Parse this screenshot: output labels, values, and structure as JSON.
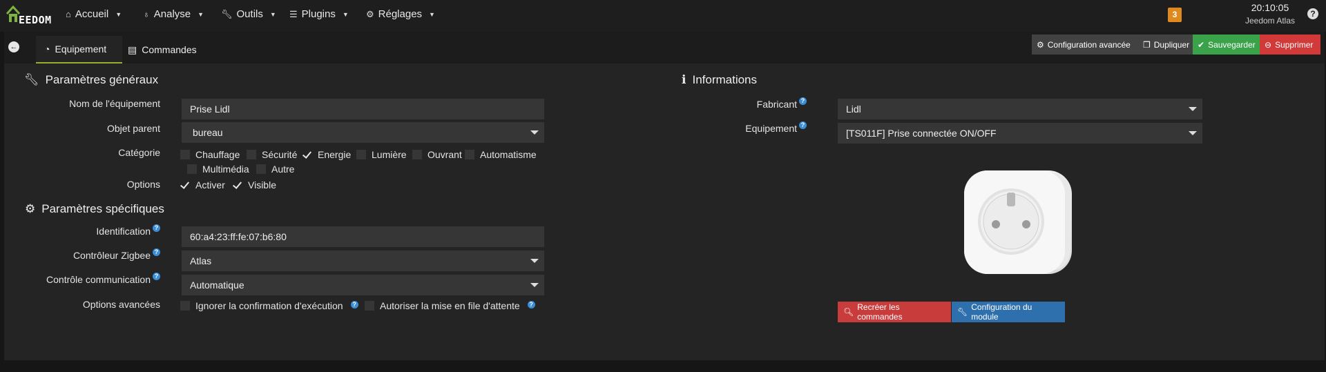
{
  "navbar": {
    "brand": "EEDOM",
    "menu": [
      {
        "label": "Accueil",
        "icon": "home-icon"
      },
      {
        "label": "Analyse",
        "icon": "stethoscope-icon"
      },
      {
        "label": "Outils",
        "icon": "wrench-icon"
      },
      {
        "label": "Plugins",
        "icon": "tasks-icon"
      },
      {
        "label": "Réglages",
        "icon": "cogs-icon"
      }
    ],
    "notification_count": "3",
    "time": "20:10:05",
    "box_name": "Jeedom Atlas"
  },
  "tabs": [
    {
      "label": "Equipement",
      "active": true
    },
    {
      "label": "Commandes",
      "active": false
    }
  ],
  "actions": {
    "advanced_config": "Configuration avancée",
    "duplicate": "Dupliquer",
    "save": "Sauvegarder",
    "delete": "Supprimer"
  },
  "general": {
    "title": "Paramètres généraux",
    "name_label": "Nom de l'équipement",
    "name_value": "Prise Lidl",
    "parent_label": "Objet parent",
    "parent_value": "bureau",
    "category_label": "Catégorie",
    "categories": [
      {
        "label": "Chauffage",
        "checked": false
      },
      {
        "label": "Sécurité",
        "checked": false
      },
      {
        "label": "Energie",
        "checked": true
      },
      {
        "label": "Lumière",
        "checked": false
      },
      {
        "label": "Ouvrant",
        "checked": false
      },
      {
        "label": "Automatisme",
        "checked": false
      },
      {
        "label": "Multimédia",
        "checked": false
      },
      {
        "label": "Autre",
        "checked": false
      }
    ],
    "options_label": "Options",
    "options": [
      {
        "label": "Activer",
        "checked": true
      },
      {
        "label": "Visible",
        "checked": true
      }
    ]
  },
  "specific": {
    "title": "Paramètres spécifiques",
    "ident_label": "Identification",
    "ident_value": "60:a4:23:ff:fe:07:b6:80",
    "controller_label": "Contrôleur Zigbee",
    "controller_value": "Atlas",
    "comm_label": "Contrôle communication",
    "comm_value": "Automatique",
    "adv_label": "Options avancées",
    "adv_options": [
      {
        "label": "Ignorer la confirmation d'exécution",
        "checked": false
      },
      {
        "label": "Autoriser la mise en file d'attente",
        "checked": false
      }
    ]
  },
  "info": {
    "title": "Informations",
    "maker_label": "Fabricant",
    "maker_value": "Lidl",
    "equip_label": "Equipement",
    "equip_value": "[TS011F] Prise connectée ON/OFF",
    "recreate_button": "Recréer les commandes",
    "module_config_button": "Configuration du module"
  },
  "colors": {
    "accent_tab": "#9fae28",
    "save": "#3aa34a",
    "delete": "#d23a3a",
    "recreate": "#c93c3c",
    "module_config": "#2e6fad",
    "badge": "#e08a1e"
  }
}
